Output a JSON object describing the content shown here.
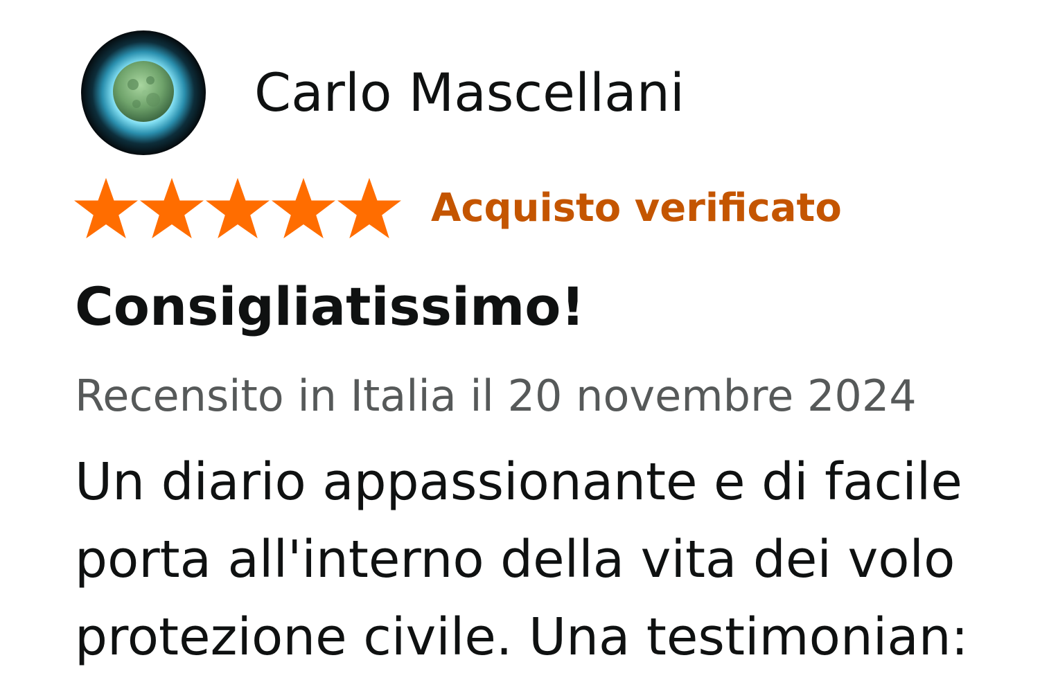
{
  "reviewer": {
    "name": "Carlo Mascellani",
    "avatar_icon": "moon-avatar-icon"
  },
  "rating": {
    "value": 5,
    "max": 5,
    "star_color": "#ff6d00",
    "verified_label": "Acquisto verificato",
    "verified_color": "#c45500"
  },
  "review": {
    "title": "Consigliatissimo!",
    "date": "Recensito in Italia il 20 novembre 2024",
    "body_lines": [
      "Un diario appassionante e di facile",
      "porta all'interno della vita dei volo",
      "protezione civile. Una testimonian:"
    ]
  }
}
